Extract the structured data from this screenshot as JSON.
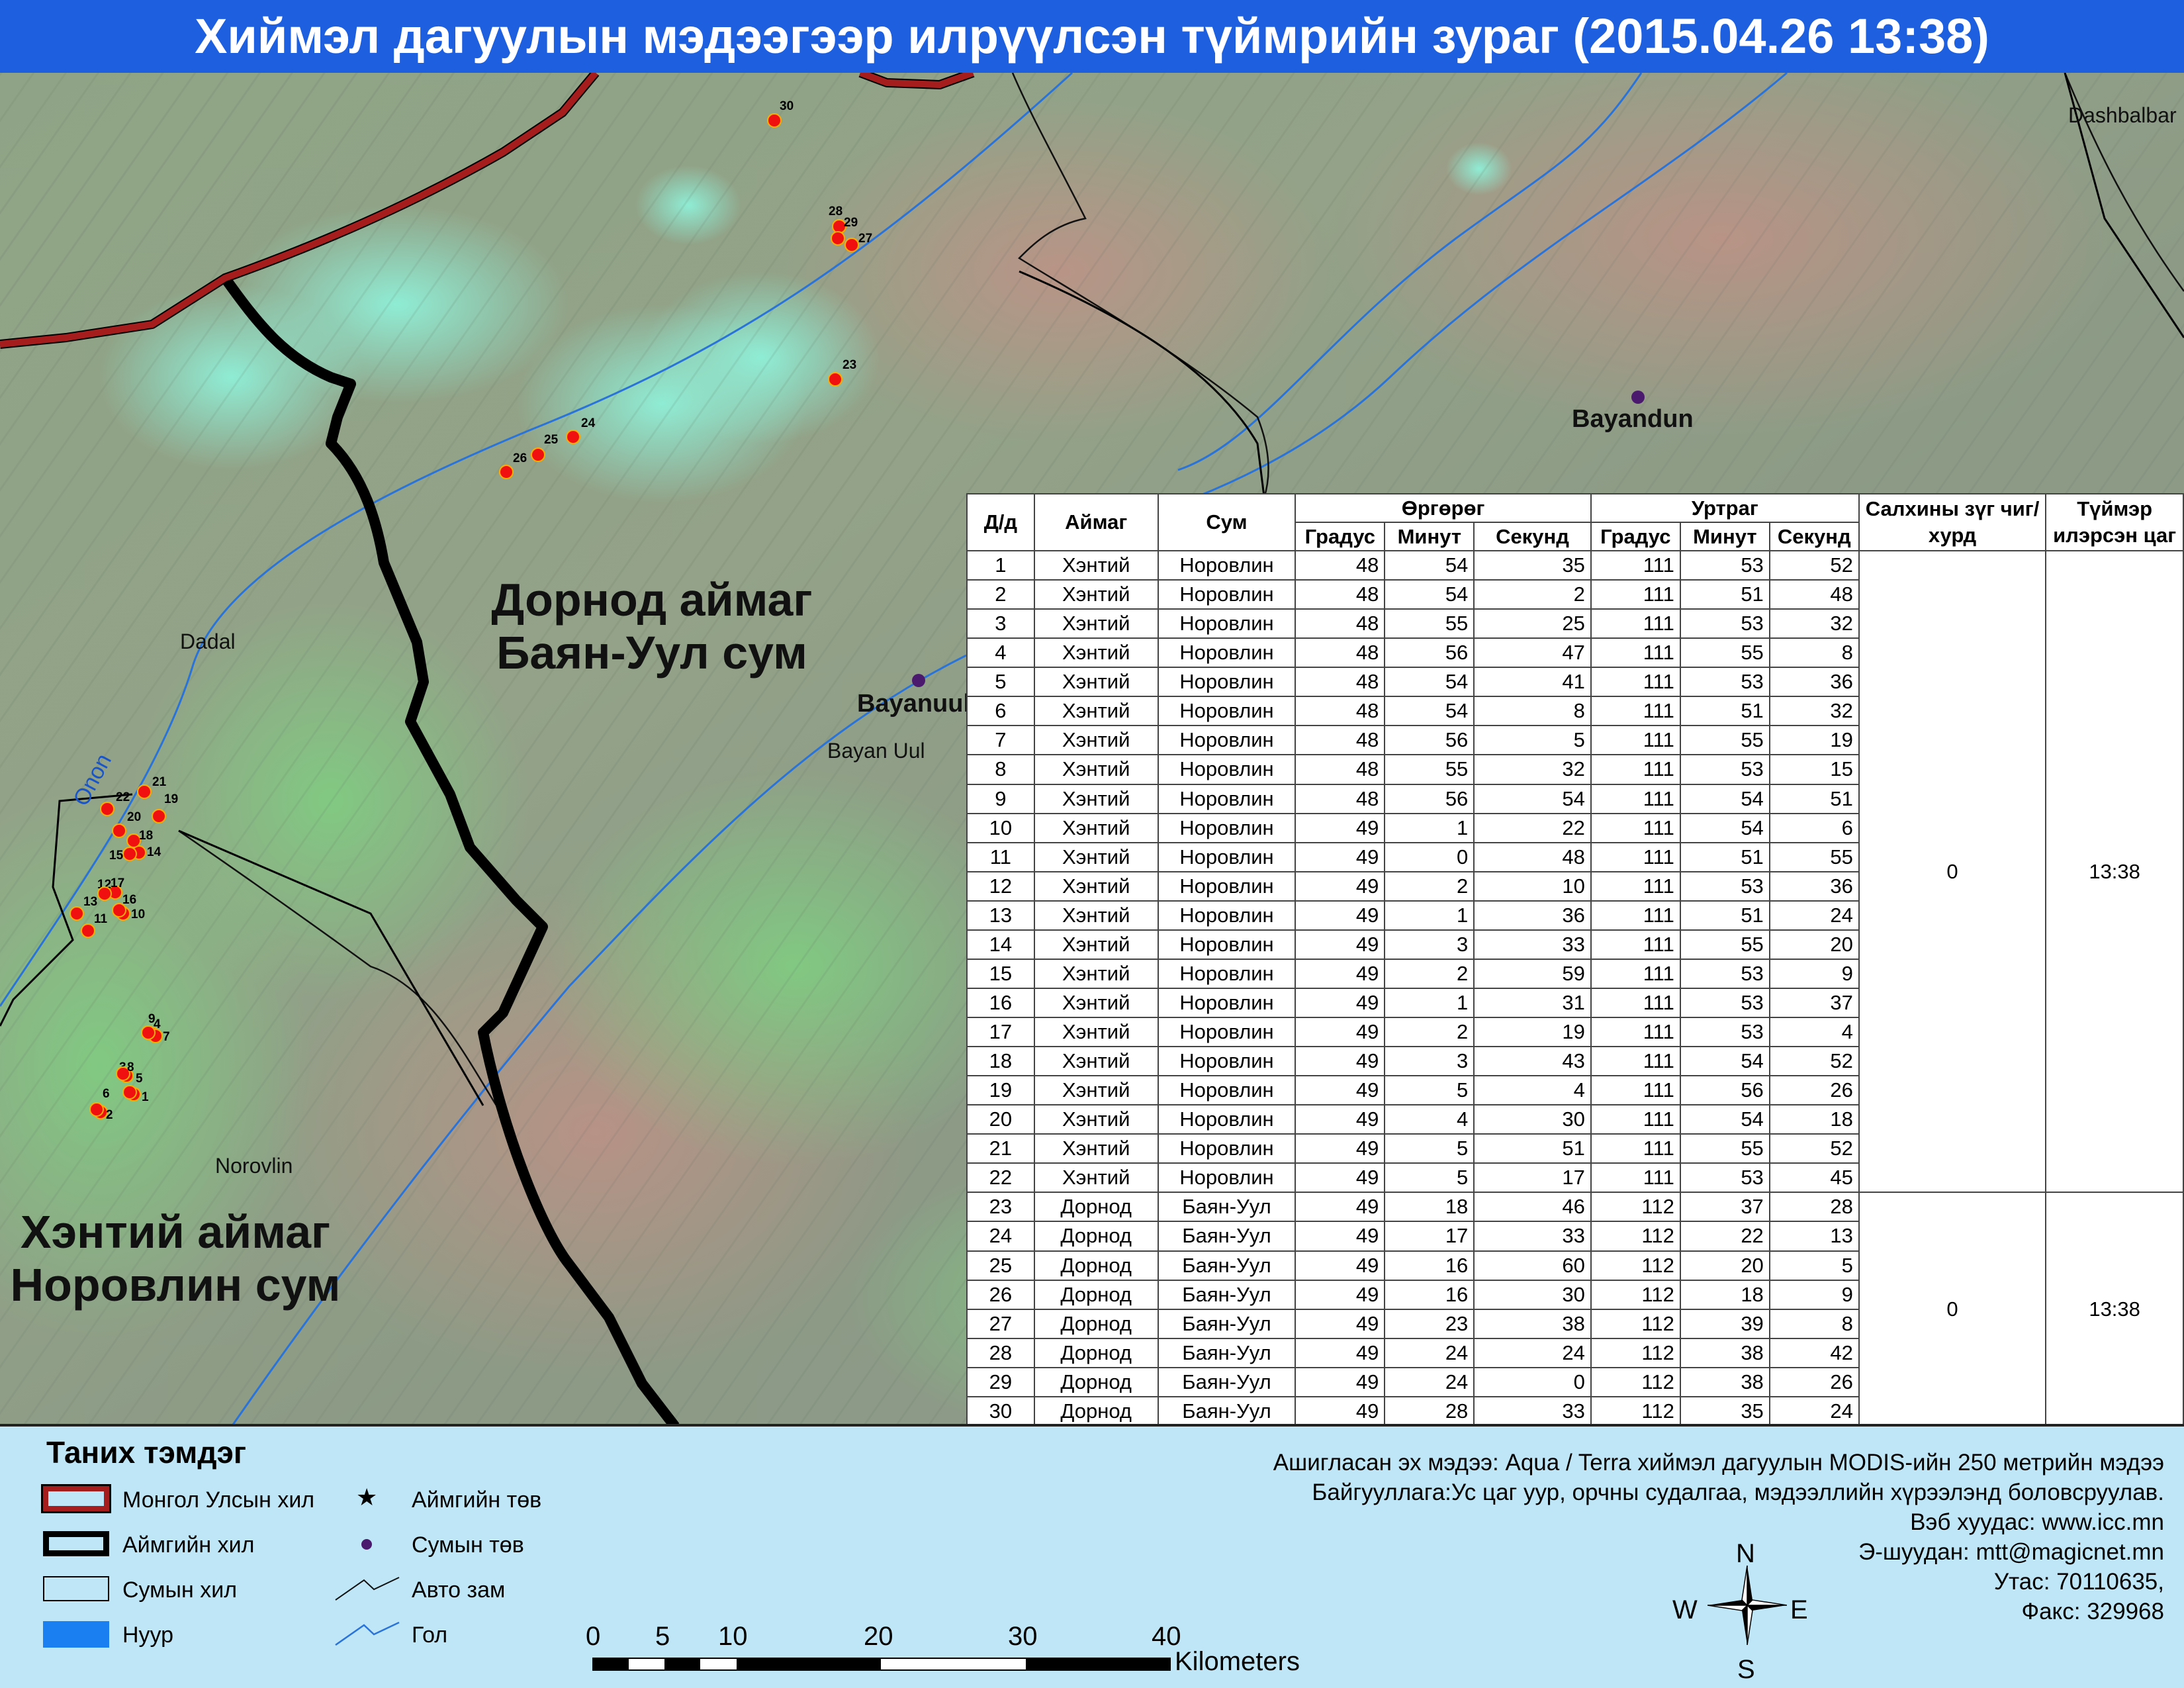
{
  "title": "Хиймэл дагуулын мэдээгээр илрүүлсэн түймрийн зураг  (2015.04.26 13:38)",
  "map": {
    "region_labels": {
      "dornod_line1": "Дорнод аймаг",
      "dornod_line2": "Баян-Уул сум",
      "khentii_line1": "Хэнтий аймаг",
      "khentii_line2": "Норовлин сум"
    },
    "place_labels": {
      "dashbalbar": "Dashbalbar",
      "bayandun": "Bayandun",
      "bayanuul_center": "Bayanuul",
      "bayan_uul": "Bayan Uul",
      "dadal": "Dadal",
      "norovlin": "Norovlin",
      "onon": "Onon"
    },
    "fire_points": [
      {
        "id": "1",
        "lat": "48°54'35\"",
        "lon": "111°53'52\""
      },
      {
        "id": "2",
        "lat": "48°54'2\"",
        "lon": "111°51'48\""
      },
      {
        "id": "3",
        "lat": "48°55'25\"",
        "lon": "111°53'32\""
      },
      {
        "id": "4",
        "lat": "48°56'47\"",
        "lon": "111°55'8\""
      },
      {
        "id": "5",
        "lat": "48°54'41\"",
        "lon": "111°53'36\""
      },
      {
        "id": "6",
        "lat": "48°54'8\"",
        "lon": "111°51'32\""
      },
      {
        "id": "7",
        "lat": "48°56'5\"",
        "lon": "111°55'19\""
      },
      {
        "id": "8",
        "lat": "48°55'32\"",
        "lon": "111°53'15\""
      },
      {
        "id": "9",
        "lat": "48°56'54\"",
        "lon": "111°54'51\""
      },
      {
        "id": "10",
        "lat": "49°1'22\"",
        "lon": "111°54'6\""
      },
      {
        "id": "11",
        "lat": "49°0'48\"",
        "lon": "111°51'55\""
      },
      {
        "id": "12",
        "lat": "49°2'10\"",
        "lon": "111°53'36\""
      },
      {
        "id": "13",
        "lat": "49°1'36\"",
        "lon": "111°51'24\""
      },
      {
        "id": "14",
        "lat": "49°3'33\"",
        "lon": "111°55'20\""
      },
      {
        "id": "15",
        "lat": "49°2'59\"",
        "lon": "111°53'9\""
      },
      {
        "id": "16",
        "lat": "49°1'31\"",
        "lon": "111°53'37\""
      },
      {
        "id": "17",
        "lat": "49°2'19\"",
        "lon": "111°53'4\""
      },
      {
        "id": "18",
        "lat": "49°3'43\"",
        "lon": "111°54'52\""
      },
      {
        "id": "19",
        "lat": "49°5'4\"",
        "lon": "111°56'26\""
      },
      {
        "id": "20",
        "lat": "49°4'30\"",
        "lon": "111°54'18\""
      },
      {
        "id": "21",
        "lat": "49°5'51\"",
        "lon": "111°55'52\""
      },
      {
        "id": "22",
        "lat": "49°5'17\"",
        "lon": "111°53'45\""
      },
      {
        "id": "23",
        "lat": "49°18'46\"",
        "lon": "112°37'28\""
      },
      {
        "id": "24",
        "lat": "49°17'33\"",
        "lon": "112°22'13\""
      },
      {
        "id": "25",
        "lat": "49°16'60\"",
        "lon": "112°20'5\""
      },
      {
        "id": "26",
        "lat": "49°16'30\"",
        "lon": "112°18'9\""
      },
      {
        "id": "27",
        "lat": "49°23'38\"",
        "lon": "112°39'8\""
      },
      {
        "id": "28",
        "lat": "49°24'24\"",
        "lon": "112°38'42\""
      },
      {
        "id": "29",
        "lat": "49°24'0\"",
        "lon": "112°38'26\""
      },
      {
        "id": "30",
        "lat": "49°28'33\"",
        "lon": "112°35'24\""
      }
    ]
  },
  "table": {
    "headers": {
      "num": "Д/д",
      "aimag": "Аймаг",
      "sum": "Сум",
      "lat": "Өргөрөг",
      "lon": "Уртраг",
      "deg": "Градус",
      "min": "Минут",
      "sec": "Секунд",
      "wind": "Салхины зүг чиг/хурд",
      "time": "Түймэр илэрсэн цаг"
    },
    "rows": [
      [
        "1",
        "Хэнтий",
        "Норовлин",
        "48",
        "54",
        "35",
        "111",
        "53",
        "52"
      ],
      [
        "2",
        "Хэнтий",
        "Норовлин",
        "48",
        "54",
        "2",
        "111",
        "51",
        "48"
      ],
      [
        "3",
        "Хэнтий",
        "Норовлин",
        "48",
        "55",
        "25",
        "111",
        "53",
        "32"
      ],
      [
        "4",
        "Хэнтий",
        "Норовлин",
        "48",
        "56",
        "47",
        "111",
        "55",
        "8"
      ],
      [
        "5",
        "Хэнтий",
        "Норовлин",
        "48",
        "54",
        "41",
        "111",
        "53",
        "36"
      ],
      [
        "6",
        "Хэнтий",
        "Норовлин",
        "48",
        "54",
        "8",
        "111",
        "51",
        "32"
      ],
      [
        "7",
        "Хэнтий",
        "Норовлин",
        "48",
        "56",
        "5",
        "111",
        "55",
        "19"
      ],
      [
        "8",
        "Хэнтий",
        "Норовлин",
        "48",
        "55",
        "32",
        "111",
        "53",
        "15"
      ],
      [
        "9",
        "Хэнтий",
        "Норовлин",
        "48",
        "56",
        "54",
        "111",
        "54",
        "51"
      ],
      [
        "10",
        "Хэнтий",
        "Норовлин",
        "49",
        "1",
        "22",
        "111",
        "54",
        "6"
      ],
      [
        "11",
        "Хэнтий",
        "Норовлин",
        "49",
        "0",
        "48",
        "111",
        "51",
        "55"
      ],
      [
        "12",
        "Хэнтий",
        "Норовлин",
        "49",
        "2",
        "10",
        "111",
        "53",
        "36"
      ],
      [
        "13",
        "Хэнтий",
        "Норовлин",
        "49",
        "1",
        "36",
        "111",
        "51",
        "24"
      ],
      [
        "14",
        "Хэнтий",
        "Норовлин",
        "49",
        "3",
        "33",
        "111",
        "55",
        "20"
      ],
      [
        "15",
        "Хэнтий",
        "Норовлин",
        "49",
        "2",
        "59",
        "111",
        "53",
        "9"
      ],
      [
        "16",
        "Хэнтий",
        "Норовлин",
        "49",
        "1",
        "31",
        "111",
        "53",
        "37"
      ],
      [
        "17",
        "Хэнтий",
        "Норовлин",
        "49",
        "2",
        "19",
        "111",
        "53",
        "4"
      ],
      [
        "18",
        "Хэнтий",
        "Норовлин",
        "49",
        "3",
        "43",
        "111",
        "54",
        "52"
      ],
      [
        "19",
        "Хэнтий",
        "Норовлин",
        "49",
        "5",
        "4",
        "111",
        "56",
        "26"
      ],
      [
        "20",
        "Хэнтий",
        "Норовлин",
        "49",
        "4",
        "30",
        "111",
        "54",
        "18"
      ],
      [
        "21",
        "Хэнтий",
        "Норовлин",
        "49",
        "5",
        "51",
        "111",
        "55",
        "52"
      ],
      [
        "22",
        "Хэнтий",
        "Норовлин",
        "49",
        "5",
        "17",
        "111",
        "53",
        "45"
      ],
      [
        "23",
        "Дорнод",
        "Баян-Уул",
        "49",
        "18",
        "46",
        "112",
        "37",
        "28"
      ],
      [
        "24",
        "Дорнод",
        "Баян-Уул",
        "49",
        "17",
        "33",
        "112",
        "22",
        "13"
      ],
      [
        "25",
        "Дорнод",
        "Баян-Уул",
        "49",
        "16",
        "60",
        "112",
        "20",
        "5"
      ],
      [
        "26",
        "Дорнод",
        "Баян-Уул",
        "49",
        "16",
        "30",
        "112",
        "18",
        "9"
      ],
      [
        "27",
        "Дорнод",
        "Баян-Уул",
        "49",
        "23",
        "38",
        "112",
        "39",
        "8"
      ],
      [
        "28",
        "Дорнод",
        "Баян-Уул",
        "49",
        "24",
        "24",
        "112",
        "38",
        "42"
      ],
      [
        "29",
        "Дорнод",
        "Баян-Уул",
        "49",
        "24",
        "0",
        "112",
        "38",
        "26"
      ],
      [
        "30",
        "Дорнод",
        "Баян-Уул",
        "49",
        "28",
        "33",
        "112",
        "35",
        "24"
      ]
    ],
    "groups": [
      {
        "wind": "0",
        "time": "13:38",
        "rows": 22
      },
      {
        "wind": "0",
        "time": "13:38",
        "rows": 8
      }
    ]
  },
  "legend": {
    "title": "Таних тэмдэг",
    "items": {
      "national_border": "Монгол Улсын хил",
      "aimag_border": "Аймгийн хил",
      "sum_border": "Сумын хил",
      "lake": "Нуур",
      "aimag_center": "Аймгийн төв",
      "sum_center": "Сумын төв",
      "road": "Авто зам",
      "river": "Гол"
    },
    "colors": {
      "national_border": "#a51d1d",
      "aimag_border": "#000000",
      "lake": "#1a7ff0",
      "sum_center": "#4b1a6e",
      "river": "#2a73d8",
      "fire": "#f01010"
    }
  },
  "scale_bar": {
    "ticks": [
      "0",
      "5",
      "10",
      "20",
      "30",
      "40"
    ],
    "unit": "Kilometers"
  },
  "source": {
    "line1": "Ашигласан эх мэдээ: Aqua / Terra хиймэл дагуулын MODIS-ийн 250 метрийн мэдээ",
    "line2": "Байгууллага:Ус цаг уур, орчны судалгаа, мэдээллийн хүрээлэнд боловсруулав.",
    "line3": "Вэб хуудас: www.icc.mn",
    "line4": "Э-шуудан: mtt@magicnet.mn",
    "line5": "Утас: 70110635,",
    "line6": "Факс: 329968"
  },
  "compass": {
    "n": "N",
    "s": "S",
    "e": "E",
    "w": "W"
  }
}
